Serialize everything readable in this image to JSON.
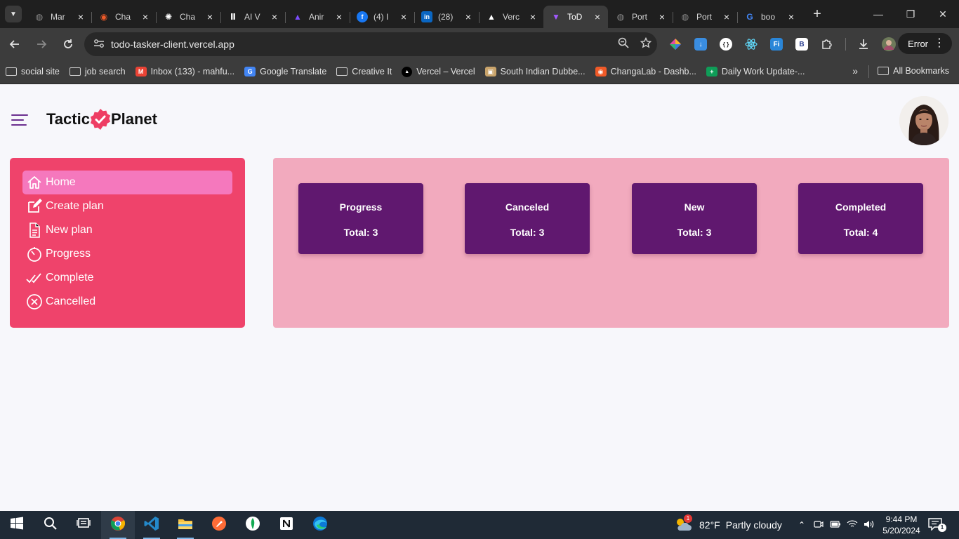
{
  "browser": {
    "tabs": [
      {
        "title": "Mar",
        "icon": "globe-icon",
        "color": "#8a8a8a",
        "active": false
      },
      {
        "title": "Cha",
        "icon": "changalab-icon",
        "color": "#f05a28",
        "active": false
      },
      {
        "title": "Cha",
        "icon": "chatgpt-icon",
        "color": "#ffffff",
        "active": false
      },
      {
        "title": "AI V",
        "icon": "ai-tool-icon",
        "color": "#ffffff",
        "active": false
      },
      {
        "title": "Anir",
        "icon": "anim-icon",
        "color": "#7c4dff",
        "active": false
      },
      {
        "title": "(4) I",
        "icon": "facebook-icon",
        "color": "#1877f2",
        "active": false
      },
      {
        "title": "(28)",
        "icon": "linkedin-icon",
        "color": "#0a66c2",
        "active": false
      },
      {
        "title": "Verc",
        "icon": "vercel-icon",
        "color": "#ffffff",
        "active": false
      },
      {
        "title": "ToD",
        "icon": "vite-icon",
        "color": "#a259ff",
        "active": true
      },
      {
        "title": "Port",
        "icon": "globe-icon",
        "color": "#8a8a8a",
        "active": false
      },
      {
        "title": "Port",
        "icon": "globe-icon",
        "color": "#8a8a8a",
        "active": false
      },
      {
        "title": "boo",
        "icon": "google-icon",
        "color": "#4285f4",
        "active": false
      }
    ],
    "url": "todo-tasker-client.vercel.app",
    "error_label": "Error",
    "bookmarks": [
      {
        "label": "social site",
        "icon": "folder-icon",
        "type": "folder"
      },
      {
        "label": "job search",
        "icon": "folder-icon",
        "type": "folder"
      },
      {
        "label": "Inbox (133) - mahfu...",
        "icon": "gmail-icon",
        "type": "site",
        "color": "#ea4335"
      },
      {
        "label": "Google Translate",
        "icon": "translate-icon",
        "type": "site",
        "color": "#4285f4"
      },
      {
        "label": "Creative It",
        "icon": "folder-icon",
        "type": "folder"
      },
      {
        "label": "Vercel – Vercel",
        "icon": "vercel-icon",
        "type": "site",
        "color": "#000000"
      },
      {
        "label": "South Indian Dubbe...",
        "icon": "movie-icon",
        "type": "site",
        "color": "#c9a46b"
      },
      {
        "label": "ChangaLab - Dashb...",
        "icon": "changalab-icon",
        "type": "site",
        "color": "#f05a28"
      },
      {
        "label": "Daily Work Update-...",
        "icon": "sheets-icon",
        "type": "site",
        "color": "#0f9d58"
      }
    ],
    "all_bookmarks_label": "All Bookmarks"
  },
  "app": {
    "brand_left": "Tactic",
    "brand_right": "Planet",
    "sidebar": [
      {
        "label": "Home",
        "icon": "home-icon",
        "active": true
      },
      {
        "label": "Create plan",
        "icon": "edit-icon",
        "active": false
      },
      {
        "label": "New plan",
        "icon": "document-icon",
        "active": false
      },
      {
        "label": "Progress",
        "icon": "timer-icon",
        "active": false
      },
      {
        "label": "Complete",
        "icon": "double-check-icon",
        "active": false
      },
      {
        "label": "Cancelled",
        "icon": "x-circle-icon",
        "active": false
      }
    ],
    "cards": [
      {
        "title": "Progress",
        "total": "Total: 3"
      },
      {
        "title": "Canceled",
        "total": "Total: 3"
      },
      {
        "title": "New",
        "total": "Total: 3"
      },
      {
        "title": "Completed",
        "total": "Total: 4"
      }
    ],
    "colors": {
      "sidebar_bg": "#ef436b",
      "sidebar_active": "#f578bd",
      "board_bg": "#f2aabe",
      "card_bg": "#60186f",
      "accent": "#6b2f8f"
    }
  },
  "taskbar": {
    "apps": [
      {
        "name": "start",
        "icon": "windows-icon"
      },
      {
        "name": "search",
        "icon": "search-icon"
      },
      {
        "name": "task-view",
        "icon": "task-view-icon"
      },
      {
        "name": "chrome",
        "icon": "chrome-icon",
        "active": true
      },
      {
        "name": "vscode",
        "icon": "vscode-icon",
        "running": true
      },
      {
        "name": "file-explorer",
        "icon": "folder-icon",
        "running": true
      },
      {
        "name": "postman",
        "icon": "postman-icon"
      },
      {
        "name": "mongodb-compass",
        "icon": "mongodb-icon"
      },
      {
        "name": "notion",
        "icon": "notion-icon"
      },
      {
        "name": "edge",
        "icon": "edge-icon"
      }
    ],
    "weather_badge": "1",
    "temperature": "82°F",
    "weather": "Partly cloudy",
    "time": "9:44 PM",
    "date": "5/20/2024",
    "notification_count": "1"
  }
}
